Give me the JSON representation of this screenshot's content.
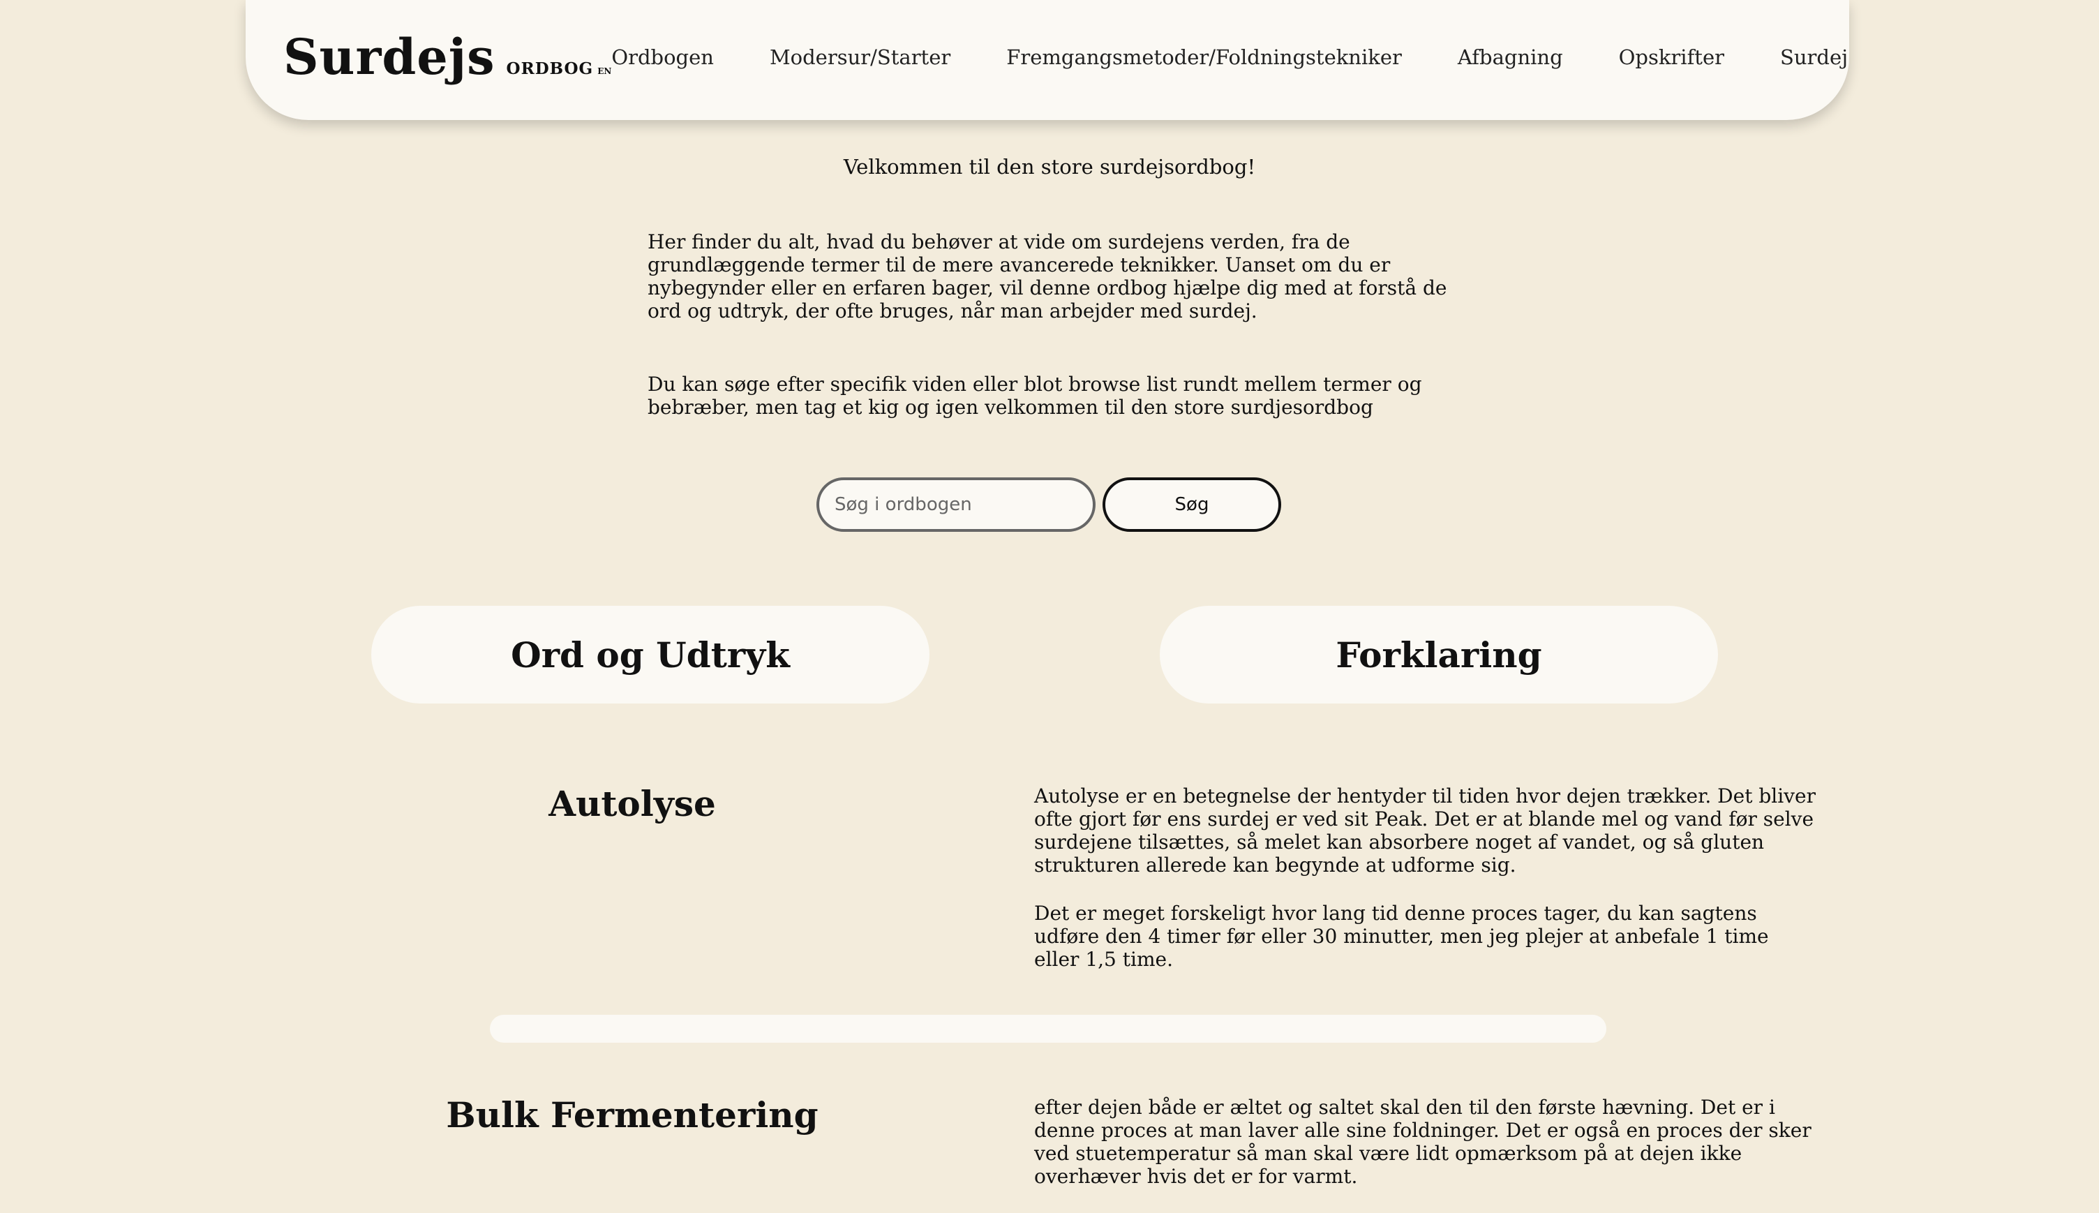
{
  "header": {
    "logo_main": "Surdejs",
    "logo_sub": "ORDBOG",
    "logo_lang": "EN",
    "nav": [
      "Ordbogen",
      "Modersur/Starter",
      "Fremgangsmetoder/Foldningstekniker",
      "Afbagning",
      "Opskrifter",
      "Surdej"
    ]
  },
  "intro": {
    "welcome": "Velkommen til den store surdejsordbog!",
    "paragraph1": "Her finder du alt, hvad du behøver at vide om surdejens verden, fra de grundlæggende termer til de mere avancerede teknikker. Uanset om du er nybegynder eller en erfaren bager, vil denne ordbog hjælpe dig med at forstå de ord og udtryk, der ofte bruges, når man arbejder med surdej.",
    "paragraph2": "Du kan søge efter specifik viden eller blot browse list rundt mellem termer og bebræber, men tag et kig og igen velkommen til den store surdjesordbog"
  },
  "search": {
    "placeholder": "Søg i ordbogen",
    "button_label": "Søg"
  },
  "columns": {
    "terms_header": "Ord og Udtryk",
    "explanation_header": "Forklaring"
  },
  "entries": [
    {
      "term": "Autolyse",
      "paragraphs": [
        "Autolyse er en betegnelse der hentyder til tiden hvor dejen trækker. Det bliver ofte gjort før ens surdej er ved sit Peak. Det er at blande mel og vand før selve surdejene tilsættes, så melet kan absorbere noget af vandet, og så gluten strukturen allerede kan begynde at udforme sig.",
        "Det er meget forskeligt hvor lang tid denne proces tager, du kan sagtens udføre den 4 timer før eller 30 minutter, men jeg plejer at anbefale 1 time eller 1,5 time."
      ]
    },
    {
      "term": "Bulk Fermentering",
      "paragraphs": [
        "efter dejen både er æltet og saltet skal den til den første hævning. Det er i denne proces at man laver alle sine foldninger. Det er også en proces der sker ved stuetemperatur så man skal være lidt opmærksom på at dejen ikke overhæver hvis det er for varmt."
      ]
    }
  ]
}
